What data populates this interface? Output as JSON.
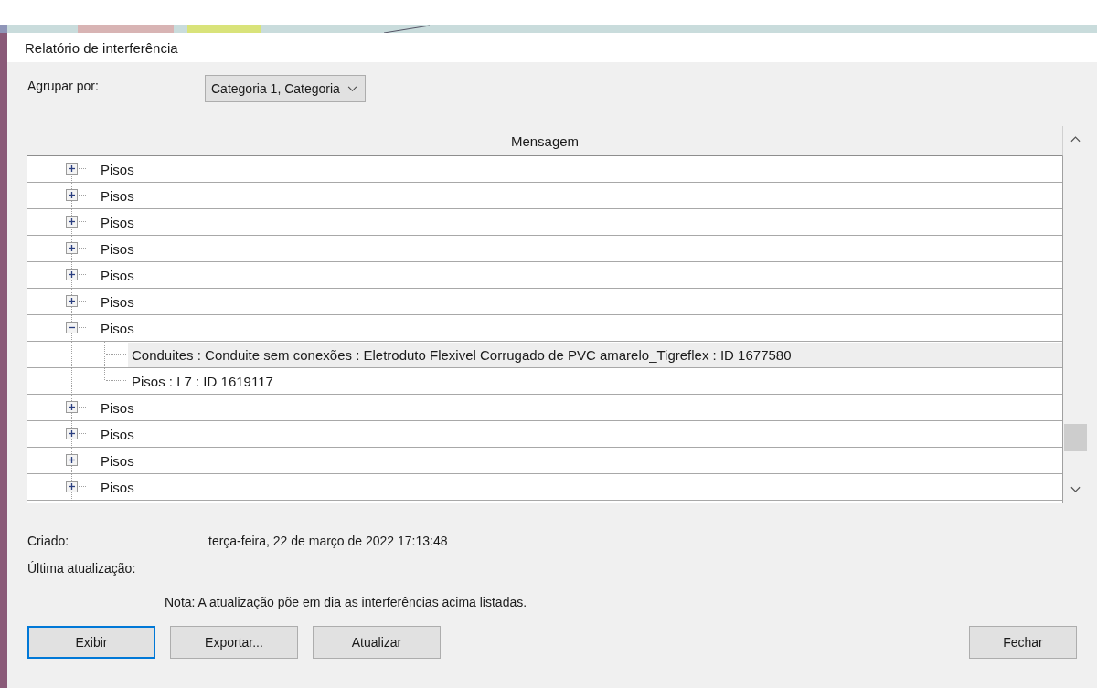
{
  "dialog": {
    "title": "Relatório de interferência"
  },
  "group_by": {
    "label": "Agrupar por:",
    "value": "Categoria 1, Categoria"
  },
  "table": {
    "column": "Mensagem",
    "rows": [
      {
        "label": "Pisos",
        "expanded": false,
        "children": []
      },
      {
        "label": "Pisos",
        "expanded": false,
        "children": []
      },
      {
        "label": "Pisos",
        "expanded": false,
        "children": []
      },
      {
        "label": "Pisos",
        "expanded": false,
        "children": []
      },
      {
        "label": "Pisos",
        "expanded": false,
        "children": []
      },
      {
        "label": "Pisos",
        "expanded": false,
        "children": []
      },
      {
        "label": "Pisos",
        "expanded": true,
        "children": [
          {
            "label": "Conduites : Conduite sem conexões : Eletroduto Flexivel Corrugado de PVC amarelo_Tigreflex : ID 1677580",
            "selected": true
          },
          {
            "label": "Pisos : L7 : ID 1619117",
            "selected": false
          }
        ]
      },
      {
        "label": "Pisos",
        "expanded": false,
        "children": []
      },
      {
        "label": "Pisos",
        "expanded": false,
        "children": []
      },
      {
        "label": "Pisos",
        "expanded": false,
        "children": []
      },
      {
        "label": "Pisos",
        "expanded": false,
        "children": []
      }
    ]
  },
  "info": {
    "created_label": "Criado:",
    "created_value": "terça-feira, 22 de março de 2022 17:13:48",
    "updated_label": "Última atualização:",
    "note": "Nota: A atualização põe em dia as interferências acima listadas."
  },
  "buttons": [
    {
      "label": "Exibir",
      "default": true
    },
    {
      "label": "Exportar...",
      "default": false
    },
    {
      "label": "Atualizar",
      "default": false
    },
    {
      "label": "Fechar",
      "default": false
    }
  ]
}
